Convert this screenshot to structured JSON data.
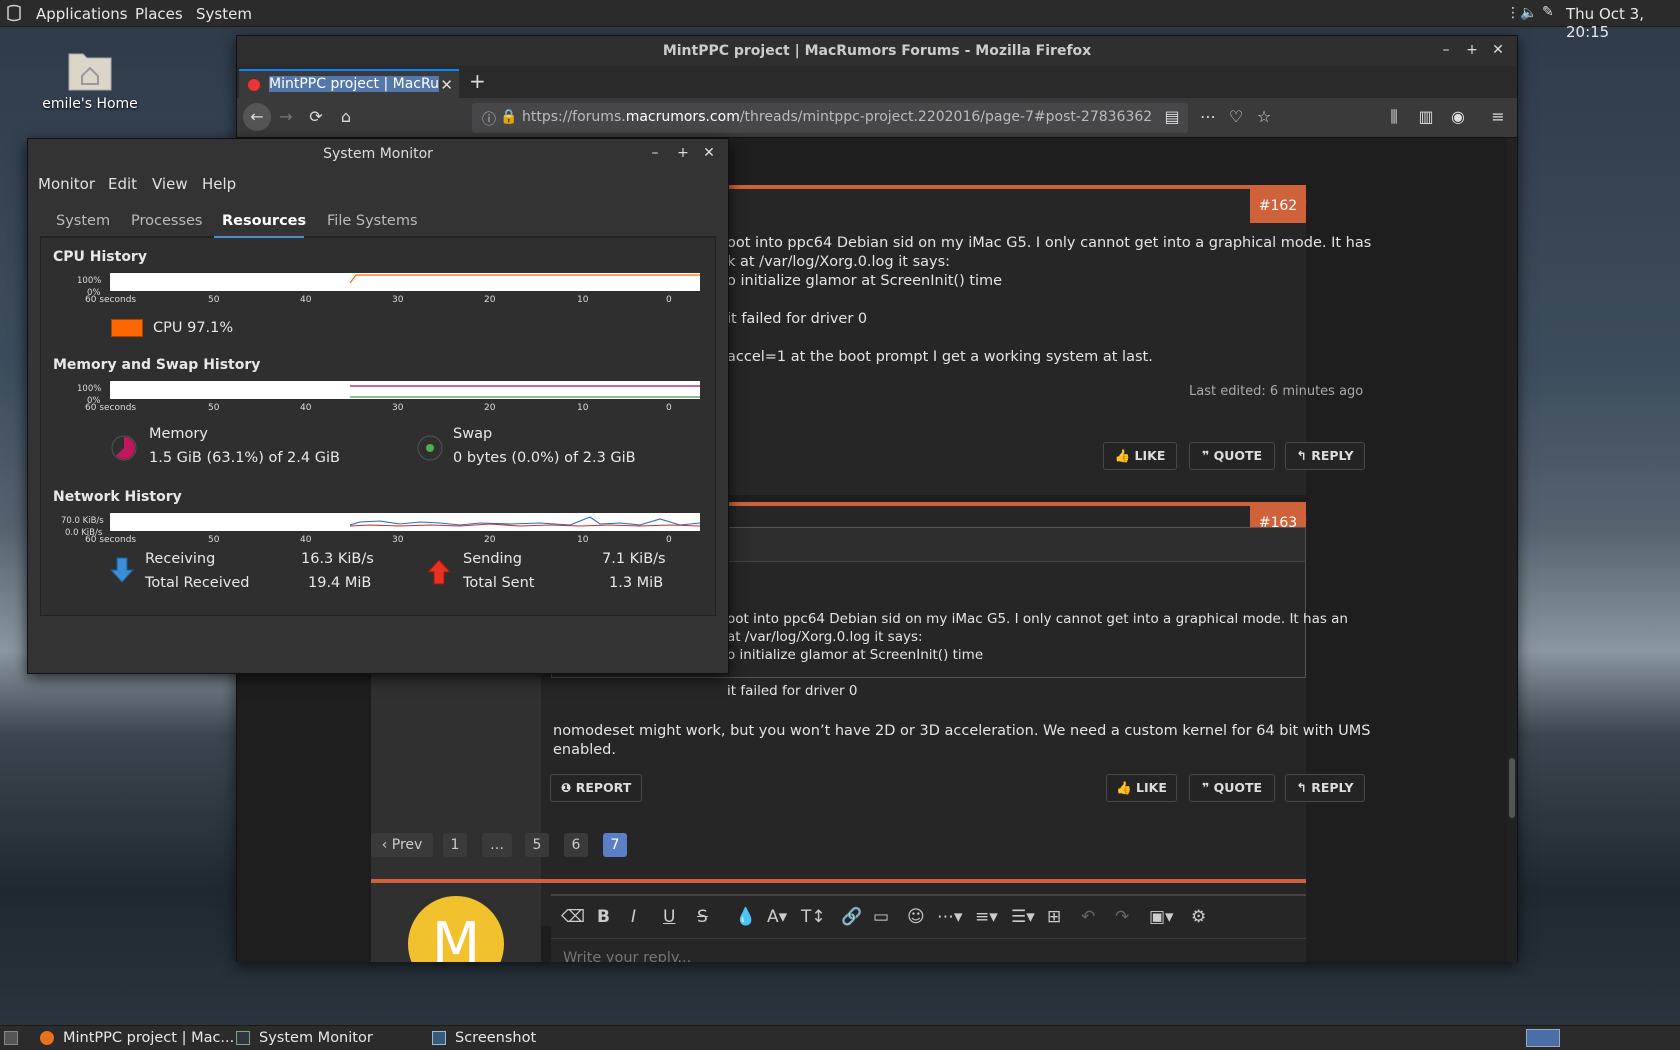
{
  "top_panel": {
    "menus": [
      "Applications",
      "Places",
      "System"
    ],
    "clock": "Thu Oct 3, 20:15"
  },
  "desktop": {
    "home_label": "emile's Home"
  },
  "firefox": {
    "window_title": "MintPPC project | MacRumors Forums - Mozilla Firefox",
    "tab_title": "MintPPC project | MacRu",
    "url_prefix": "https://forums.",
    "url_domain": "macrumors.com",
    "url_path": "/threads/mintppc-project.2202016/page-7#post-27836362"
  },
  "posts": [
    {
      "number": "#162",
      "lines": [
        "oot into ppc64 Debian sid on my iMac G5. I only cannot get into a graphical mode. It has",
        "k at /var/log/Xorg.0.log it says:",
        "o initialize glamor at ScreenInit() time",
        "it failed for driver 0",
        "accel=1 at the boot prompt I get a working system at last."
      ],
      "edited": "Last edited: 6 minutes ago",
      "buttons": [
        "LIKE",
        "QUOTE",
        "REPLY"
      ]
    },
    {
      "number": "#163",
      "quote_lines": [
        "oot into ppc64 Debian sid on my iMac G5. I only cannot get into a graphical mode. It has an",
        "at /var/log/Xorg.0.log it says:",
        "o initialize glamor at ScreenInit() time",
        "it failed for driver 0"
      ],
      "body_lines": [
        "nomodeset might work, but you won’t have 2D or 3D acceleration. We need a custom kernel for 64 bit with UMS",
        "enabled."
      ],
      "report": "REPORT",
      "buttons": [
        "LIKE",
        "QUOTE",
        "REPLY"
      ]
    }
  ],
  "pagination": [
    "‹ Prev",
    "1",
    "…",
    "5",
    "6",
    "7"
  ],
  "reply": {
    "avatar_letter": "M",
    "placeholder": "Write your reply..."
  },
  "system_monitor": {
    "title": "System Monitor",
    "menus": [
      "Monitor",
      "Edit",
      "View",
      "Help"
    ],
    "tabs": [
      "System",
      "Processes",
      "Resources",
      "File Systems"
    ],
    "active_tab": "Resources",
    "x_ticks": [
      "60 seconds",
      "50",
      "40",
      "30",
      "20",
      "10",
      "0"
    ],
    "cpu": {
      "title": "CPU History",
      "y_labels": [
        "100%",
        "0%"
      ],
      "legend": "CPU",
      "value": "97.1%",
      "color": "#ff6600"
    },
    "memory": {
      "title": "Memory and Swap History",
      "y_labels": [
        "100%",
        "0%"
      ],
      "memory_label": "Memory",
      "memory_value": "1.5 GiB (63.1%) of 2.4 GiB",
      "memory_fraction": 0.631,
      "swap_label": "Swap",
      "swap_value": "0 bytes (0.0%) of 2.3 GiB"
    },
    "network": {
      "title": "Network History",
      "y_labels": [
        "70.0 KiB/s",
        "0.0 KiB/s"
      ],
      "receiving_label": "Receiving",
      "receiving_value": "16.3 KiB/s",
      "total_received_label": "Total Received",
      "total_received_value": "19.4 MiB",
      "sending_label": "Sending",
      "sending_value": "7.1 KiB/s",
      "total_sent_label": "Total Sent",
      "total_sent_value": "1.3 MiB"
    }
  },
  "taskbar": {
    "items": [
      "MintPPC project | Mac...",
      "System Monitor",
      "Screenshot"
    ]
  }
}
